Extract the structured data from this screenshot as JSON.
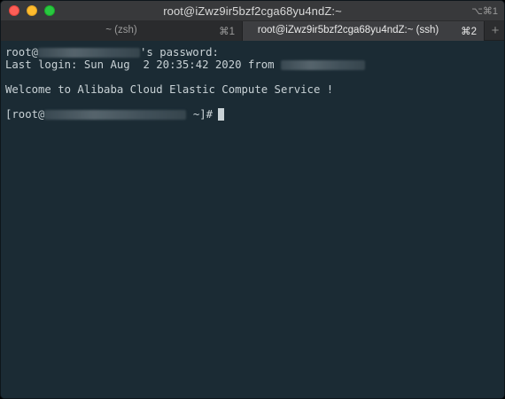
{
  "window": {
    "title": "root@iZwz9ir5bzf2cga68yu4ndZ:~",
    "title_shortcut": "⌥⌘1"
  },
  "tabs": [
    {
      "label": "~ (zsh)",
      "shortcut": "⌘1",
      "active": false
    },
    {
      "label": "root@iZwz9ir5bzf2cga68yu4ndZ:~ (ssh)",
      "shortcut": "⌘2",
      "active": true
    }
  ],
  "new_tab_label": "+",
  "terminal": {
    "line1_prefix": "root@",
    "line1_suffix": "'s password:",
    "line2_prefix": "Last login: Sun Aug  2 20:35:42 2020 from ",
    "welcome": "Welcome to Alibaba Cloud Elastic Compute Service !",
    "prompt_prefix": "[root@",
    "prompt_suffix": " ~]#"
  },
  "colors": {
    "terminal_bg": "#1b2b34",
    "terminal_fg": "#c9d2d6",
    "titlebar_bg": "#38393b",
    "close": "#fe5f57",
    "minimize": "#febc2e",
    "maximize": "#28c840"
  },
  "icons": {
    "close": "close-dot-icon",
    "minimize": "minimize-dot-icon",
    "maximize": "maximize-dot-icon",
    "new_tab": "plus-icon"
  }
}
